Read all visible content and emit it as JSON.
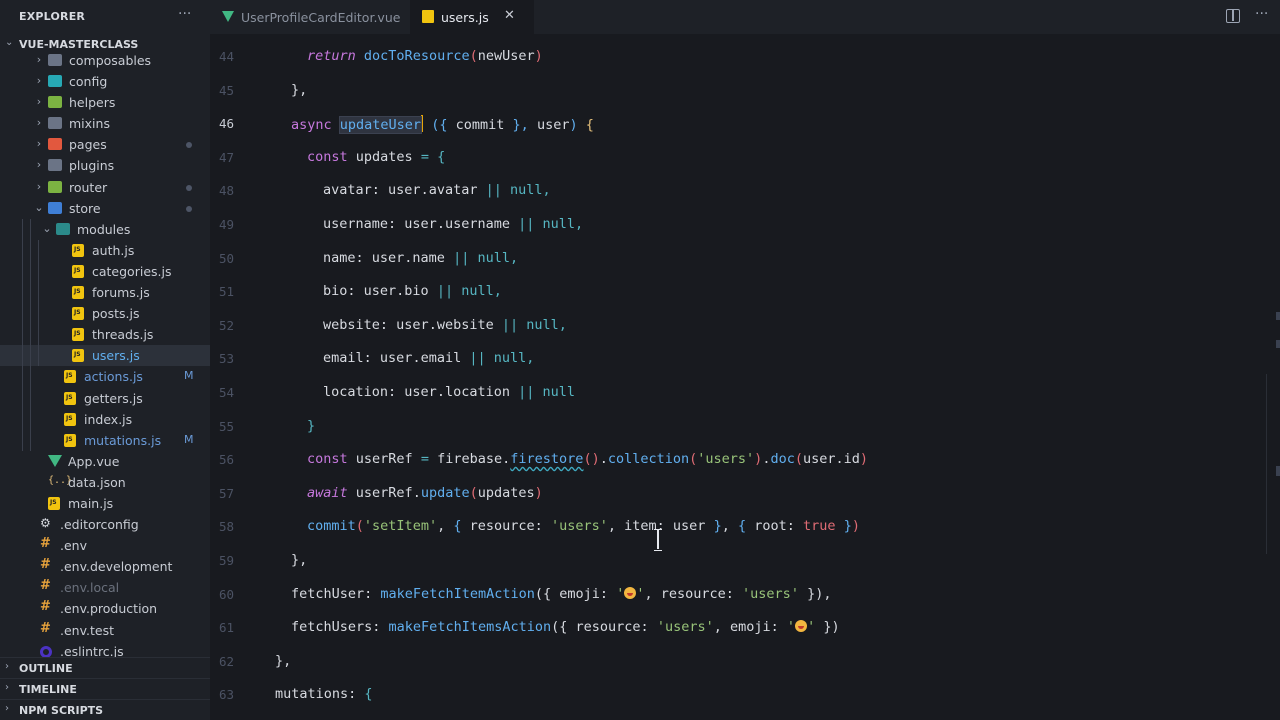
{
  "sidebar": {
    "title": "EXPLORER",
    "more": "···",
    "root_label": "VUE-MASTERCLASS",
    "items": [
      {
        "label": "composables",
        "type": "folder"
      },
      {
        "label": "config",
        "type": "folder-cyan"
      },
      {
        "label": "helpers",
        "type": "folder-green"
      },
      {
        "label": "mixins",
        "type": "folder"
      },
      {
        "label": "pages",
        "type": "folder-red",
        "modified": true
      },
      {
        "label": "plugins",
        "type": "folder"
      },
      {
        "label": "router",
        "type": "folder-green",
        "modified": true
      },
      {
        "label": "store",
        "type": "folder-blue",
        "expanded": true,
        "modified": true
      },
      {
        "label": "modules",
        "type": "folder-teal",
        "expanded": true
      },
      {
        "label": "auth.js",
        "type": "js"
      },
      {
        "label": "categories.js",
        "type": "js"
      },
      {
        "label": "forums.js",
        "type": "js"
      },
      {
        "label": "posts.js",
        "type": "js"
      },
      {
        "label": "threads.js",
        "type": "js"
      },
      {
        "label": "users.js",
        "type": "js",
        "selected": true
      },
      {
        "label": "actions.js",
        "type": "js",
        "badge": "M"
      },
      {
        "label": "getters.js",
        "type": "js"
      },
      {
        "label": "index.js",
        "type": "js"
      },
      {
        "label": "mutations.js",
        "type": "js",
        "badge": "M"
      },
      {
        "label": "App.vue",
        "type": "vue"
      },
      {
        "label": "data.json",
        "type": "json"
      },
      {
        "label": "main.js",
        "type": "js"
      },
      {
        "label": ".editorconfig",
        "type": "gear"
      },
      {
        "label": ".env",
        "type": "env"
      },
      {
        "label": ".env.development",
        "type": "env"
      },
      {
        "label": ".env.local",
        "type": "env",
        "dim": true
      },
      {
        "label": ".env.production",
        "type": "env"
      },
      {
        "label": ".env.test",
        "type": "env"
      },
      {
        "label": ".eslintrc.js",
        "type": "eslint"
      }
    ],
    "sections": [
      "OUTLINE",
      "TIMELINE",
      "NPM SCRIPTS"
    ]
  },
  "tabs": [
    {
      "label": "UserProfileCardEditor.vue",
      "active": false
    },
    {
      "label": "users.js",
      "active": true
    }
  ],
  "tab_close": "✕",
  "editor": {
    "current_line": "46",
    "lines": [
      {
        "n": "44"
      },
      {
        "n": "45"
      },
      {
        "n": "46"
      },
      {
        "n": "47"
      },
      {
        "n": "48"
      },
      {
        "n": "49"
      },
      {
        "n": "50"
      },
      {
        "n": "51"
      },
      {
        "n": "52"
      },
      {
        "n": "53"
      },
      {
        "n": "54"
      },
      {
        "n": "55"
      },
      {
        "n": "56"
      },
      {
        "n": "57"
      },
      {
        "n": "58"
      },
      {
        "n": "59"
      },
      {
        "n": "60"
      },
      {
        "n": "61"
      },
      {
        "n": "62"
      },
      {
        "n": "63"
      }
    ],
    "code": {
      "l44": [
        "return",
        "docToResource",
        "(",
        "newUser",
        ")"
      ],
      "l45": "},",
      "l46": [
        "async",
        "updateUser",
        "({",
        "commit",
        "},",
        "user",
        ")",
        "{"
      ],
      "l47": [
        "const",
        "updates",
        "=",
        "{"
      ],
      "l48": [
        "avatar:",
        "user",
        ".avatar",
        "||",
        "null,"
      ],
      "l49": [
        "username:",
        "user",
        ".username",
        "||",
        "null,"
      ],
      "l50": [
        "name:",
        "user",
        ".name",
        "||",
        "null,"
      ],
      "l51": [
        "bio:",
        "user",
        ".bio",
        "||",
        "null,"
      ],
      "l52": [
        "website:",
        "user",
        ".website",
        "||",
        "null,"
      ],
      "l53": [
        "email:",
        "user",
        ".email",
        "||",
        "null,"
      ],
      "l54": [
        "location:",
        "user",
        ".location",
        "||",
        "null"
      ],
      "l55": "}",
      "l56": [
        "const",
        "userRef",
        "=",
        "firebase",
        ".",
        "firestore",
        "()",
        ".",
        "collection",
        "(",
        "'users'",
        ")",
        ".",
        "doc",
        "(",
        "user.id",
        ")"
      ],
      "l57": [
        "await",
        "userRef",
        ".",
        "update",
        "(",
        "updates",
        ")"
      ],
      "l58": [
        "commit",
        "(",
        "'setItem'",
        ",",
        "{",
        "resource:",
        "'users'",
        ",",
        "item:",
        "user",
        "}",
        ",",
        "{",
        "root:",
        "true",
        "}",
        ")"
      ],
      "l59": "},",
      "l60": [
        "fetchUser:",
        "makeFetchItemAction",
        "({",
        "emoji:",
        "'",
        "'",
        ",",
        "resource:",
        "'users'",
        "}),"
      ],
      "l61": [
        "fetchUsers:",
        "makeFetchItemsAction",
        "({",
        "resource:",
        "'users'",
        ",",
        "emoji:",
        "'",
        "'",
        "})"
      ],
      "l62": "},",
      "l63": [
        "mutations:",
        "{"
      ]
    }
  }
}
